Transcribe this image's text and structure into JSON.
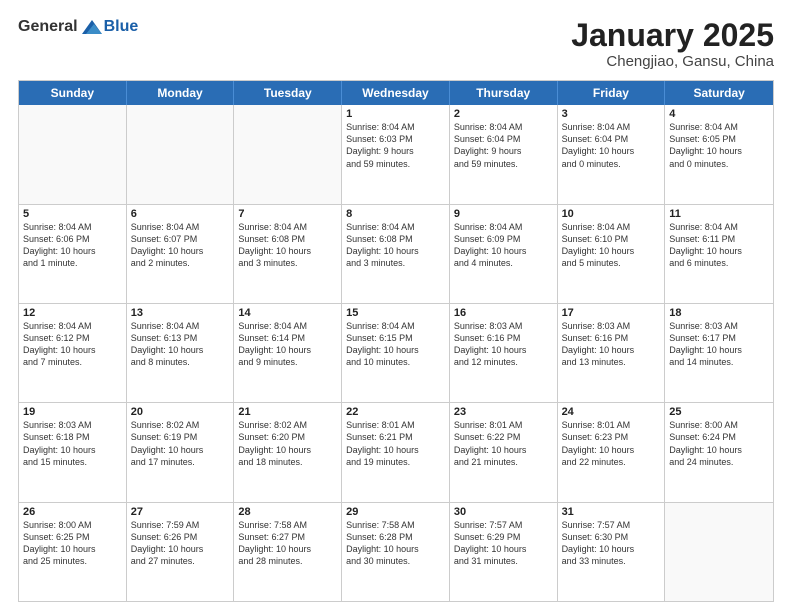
{
  "header": {
    "logo": {
      "general": "General",
      "blue": "Blue"
    },
    "title": "January 2025",
    "location": "Chengjiao, Gansu, China"
  },
  "weekdays": [
    "Sunday",
    "Monday",
    "Tuesday",
    "Wednesday",
    "Thursday",
    "Friday",
    "Saturday"
  ],
  "rows": [
    [
      {
        "day": "",
        "info": ""
      },
      {
        "day": "",
        "info": ""
      },
      {
        "day": "",
        "info": ""
      },
      {
        "day": "1",
        "info": "Sunrise: 8:04 AM\nSunset: 6:03 PM\nDaylight: 9 hours\nand 59 minutes."
      },
      {
        "day": "2",
        "info": "Sunrise: 8:04 AM\nSunset: 6:04 PM\nDaylight: 9 hours\nand 59 minutes."
      },
      {
        "day": "3",
        "info": "Sunrise: 8:04 AM\nSunset: 6:04 PM\nDaylight: 10 hours\nand 0 minutes."
      },
      {
        "day": "4",
        "info": "Sunrise: 8:04 AM\nSunset: 6:05 PM\nDaylight: 10 hours\nand 0 minutes."
      }
    ],
    [
      {
        "day": "5",
        "info": "Sunrise: 8:04 AM\nSunset: 6:06 PM\nDaylight: 10 hours\nand 1 minute."
      },
      {
        "day": "6",
        "info": "Sunrise: 8:04 AM\nSunset: 6:07 PM\nDaylight: 10 hours\nand 2 minutes."
      },
      {
        "day": "7",
        "info": "Sunrise: 8:04 AM\nSunset: 6:08 PM\nDaylight: 10 hours\nand 3 minutes."
      },
      {
        "day": "8",
        "info": "Sunrise: 8:04 AM\nSunset: 6:08 PM\nDaylight: 10 hours\nand 3 minutes."
      },
      {
        "day": "9",
        "info": "Sunrise: 8:04 AM\nSunset: 6:09 PM\nDaylight: 10 hours\nand 4 minutes."
      },
      {
        "day": "10",
        "info": "Sunrise: 8:04 AM\nSunset: 6:10 PM\nDaylight: 10 hours\nand 5 minutes."
      },
      {
        "day": "11",
        "info": "Sunrise: 8:04 AM\nSunset: 6:11 PM\nDaylight: 10 hours\nand 6 minutes."
      }
    ],
    [
      {
        "day": "12",
        "info": "Sunrise: 8:04 AM\nSunset: 6:12 PM\nDaylight: 10 hours\nand 7 minutes."
      },
      {
        "day": "13",
        "info": "Sunrise: 8:04 AM\nSunset: 6:13 PM\nDaylight: 10 hours\nand 8 minutes."
      },
      {
        "day": "14",
        "info": "Sunrise: 8:04 AM\nSunset: 6:14 PM\nDaylight: 10 hours\nand 9 minutes."
      },
      {
        "day": "15",
        "info": "Sunrise: 8:04 AM\nSunset: 6:15 PM\nDaylight: 10 hours\nand 10 minutes."
      },
      {
        "day": "16",
        "info": "Sunrise: 8:03 AM\nSunset: 6:16 PM\nDaylight: 10 hours\nand 12 minutes."
      },
      {
        "day": "17",
        "info": "Sunrise: 8:03 AM\nSunset: 6:16 PM\nDaylight: 10 hours\nand 13 minutes."
      },
      {
        "day": "18",
        "info": "Sunrise: 8:03 AM\nSunset: 6:17 PM\nDaylight: 10 hours\nand 14 minutes."
      }
    ],
    [
      {
        "day": "19",
        "info": "Sunrise: 8:03 AM\nSunset: 6:18 PM\nDaylight: 10 hours\nand 15 minutes."
      },
      {
        "day": "20",
        "info": "Sunrise: 8:02 AM\nSunset: 6:19 PM\nDaylight: 10 hours\nand 17 minutes."
      },
      {
        "day": "21",
        "info": "Sunrise: 8:02 AM\nSunset: 6:20 PM\nDaylight: 10 hours\nand 18 minutes."
      },
      {
        "day": "22",
        "info": "Sunrise: 8:01 AM\nSunset: 6:21 PM\nDaylight: 10 hours\nand 19 minutes."
      },
      {
        "day": "23",
        "info": "Sunrise: 8:01 AM\nSunset: 6:22 PM\nDaylight: 10 hours\nand 21 minutes."
      },
      {
        "day": "24",
        "info": "Sunrise: 8:01 AM\nSunset: 6:23 PM\nDaylight: 10 hours\nand 22 minutes."
      },
      {
        "day": "25",
        "info": "Sunrise: 8:00 AM\nSunset: 6:24 PM\nDaylight: 10 hours\nand 24 minutes."
      }
    ],
    [
      {
        "day": "26",
        "info": "Sunrise: 8:00 AM\nSunset: 6:25 PM\nDaylight: 10 hours\nand 25 minutes."
      },
      {
        "day": "27",
        "info": "Sunrise: 7:59 AM\nSunset: 6:26 PM\nDaylight: 10 hours\nand 27 minutes."
      },
      {
        "day": "28",
        "info": "Sunrise: 7:58 AM\nSunset: 6:27 PM\nDaylight: 10 hours\nand 28 minutes."
      },
      {
        "day": "29",
        "info": "Sunrise: 7:58 AM\nSunset: 6:28 PM\nDaylight: 10 hours\nand 30 minutes."
      },
      {
        "day": "30",
        "info": "Sunrise: 7:57 AM\nSunset: 6:29 PM\nDaylight: 10 hours\nand 31 minutes."
      },
      {
        "day": "31",
        "info": "Sunrise: 7:57 AM\nSunset: 6:30 PM\nDaylight: 10 hours\nand 33 minutes."
      },
      {
        "day": "",
        "info": ""
      }
    ]
  ]
}
